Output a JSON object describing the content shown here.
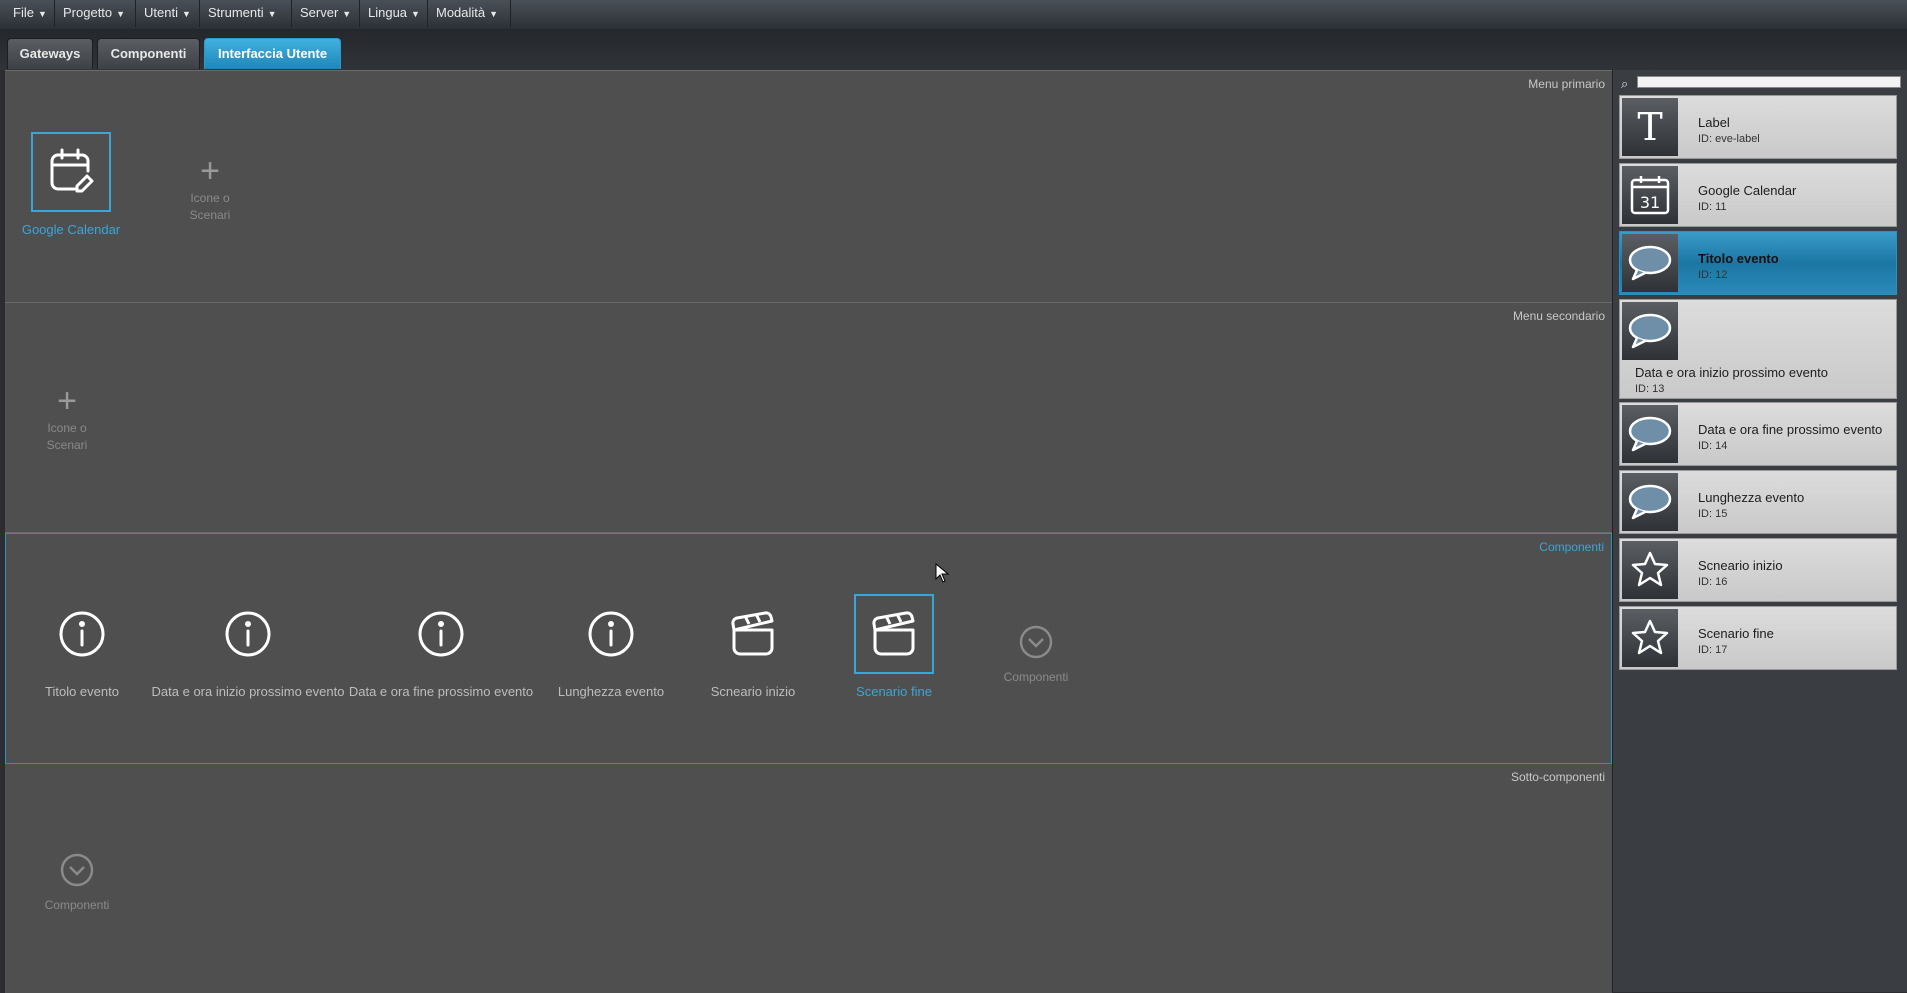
{
  "menu": {
    "file": "File",
    "progetto": "Progetto",
    "utenti": "Utenti",
    "strumenti": "Strumenti",
    "server": "Server",
    "lingua": "Lingua",
    "modalita": "Modalità"
  },
  "tabs": {
    "gateways": "Gateways",
    "componenti": "Componenti",
    "interfaccia": "Interfaccia Utente"
  },
  "sections": {
    "primary": {
      "title": "Menu primario",
      "item_label": "Google Calendar",
      "add_line1": "Icone o",
      "add_line2": "Scenari"
    },
    "secondary": {
      "title": "Menu secondario",
      "add_line1": "Icone o",
      "add_line2": "Scenari"
    },
    "components": {
      "title": "Componenti",
      "items": [
        "Titolo evento",
        "Data e ora inizio prossimo evento",
        "Data e ora fine prossimo evento",
        "Lunghezza evento",
        "Scneario inizio",
        "Scenario fine"
      ],
      "add_label": "Componenti"
    },
    "subcomponents": {
      "title": "Sotto-componenti",
      "add_label": "Componenti"
    }
  },
  "panel": {
    "search_placeholder": "",
    "cards": [
      {
        "name": "Label",
        "id": "ID: eve-label"
      },
      {
        "name": "Google Calendar",
        "id": "ID: 11",
        "icon_text": "31"
      },
      {
        "name": "Titolo evento",
        "id": "ID: 12"
      },
      {
        "name": "Data e ora inizio prossimo evento",
        "id": "ID: 13"
      },
      {
        "name": "Data e ora fine prossimo evento",
        "id": "ID: 14"
      },
      {
        "name": "Lunghezza evento",
        "id": "ID: 15"
      },
      {
        "name": "Scneario inizio",
        "id": "ID: 16"
      },
      {
        "name": "Scenario fine",
        "id": "ID: 17"
      }
    ]
  },
  "colors": {
    "accent": "#3aa6d8",
    "canvas": "#4f4f4f",
    "panel": "#3a3d41"
  }
}
